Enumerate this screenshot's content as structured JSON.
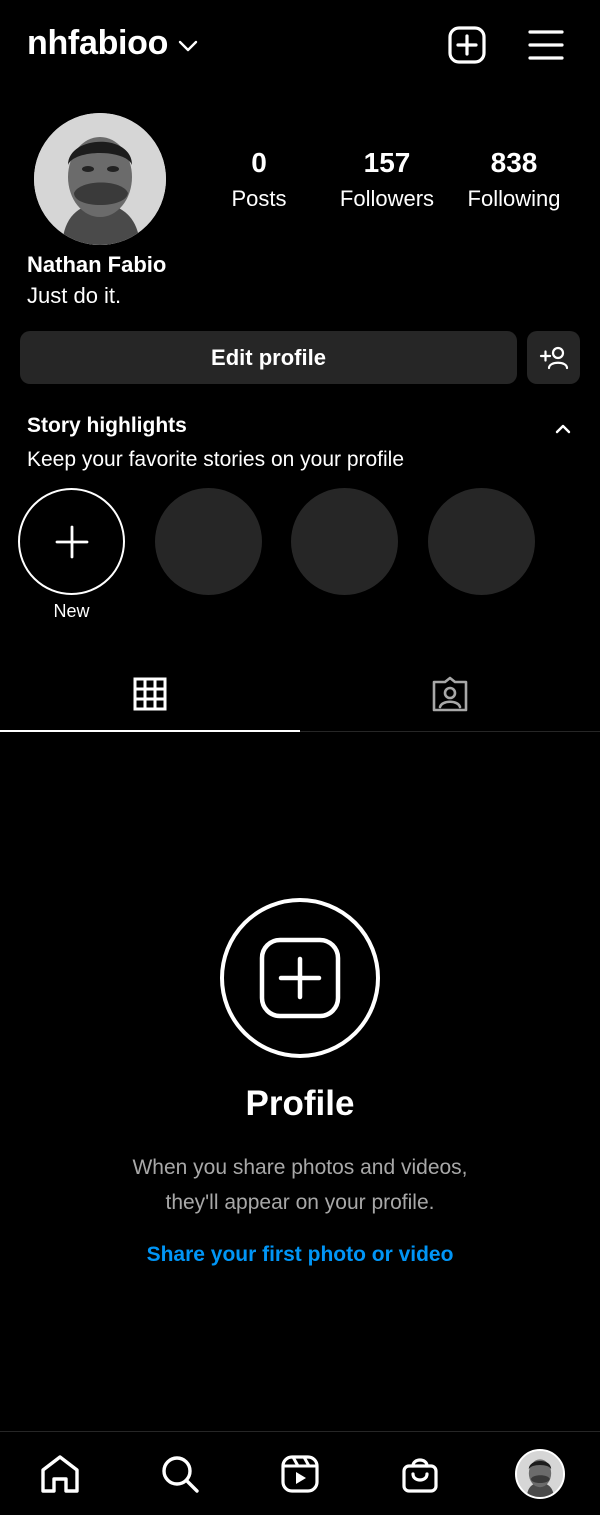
{
  "header": {
    "username": "nhfabioo",
    "icons": {
      "switch": "chevron-down-icon",
      "create": "plus-square-icon",
      "menu": "hamburger-icon"
    }
  },
  "profile": {
    "name": "Nathan Fabio",
    "bio": "Just do it.",
    "stats": [
      {
        "value": "0",
        "label": "Posts"
      },
      {
        "value": "157",
        "label": "Followers"
      },
      {
        "value": "838",
        "label": "Following"
      }
    ]
  },
  "actions": {
    "edit_profile": "Edit profile",
    "add_user_icon": "add-user-icon"
  },
  "highlights": {
    "title": "Story highlights",
    "subtitle": "Keep your favorite stories on your profile",
    "new_label": "New"
  },
  "tabs": [
    {
      "name": "grid",
      "icon": "grid-icon",
      "active": true
    },
    {
      "name": "tagged",
      "icon": "tagged-icon",
      "active": false
    }
  ],
  "empty_state": {
    "title": "Profile",
    "line1": "When you share photos and videos,",
    "line2": "they'll appear on your profile.",
    "cta": "Share your first photo or video"
  },
  "bottom_nav": [
    {
      "name": "home",
      "icon": "home-icon"
    },
    {
      "name": "search",
      "icon": "search-icon"
    },
    {
      "name": "reels",
      "icon": "reels-icon"
    },
    {
      "name": "shop",
      "icon": "shop-icon"
    },
    {
      "name": "profile",
      "icon": "avatar-icon"
    }
  ],
  "colors": {
    "background": "#000000",
    "surface": "#262626",
    "link": "#0095f6",
    "muted": "#a8a8a8"
  }
}
